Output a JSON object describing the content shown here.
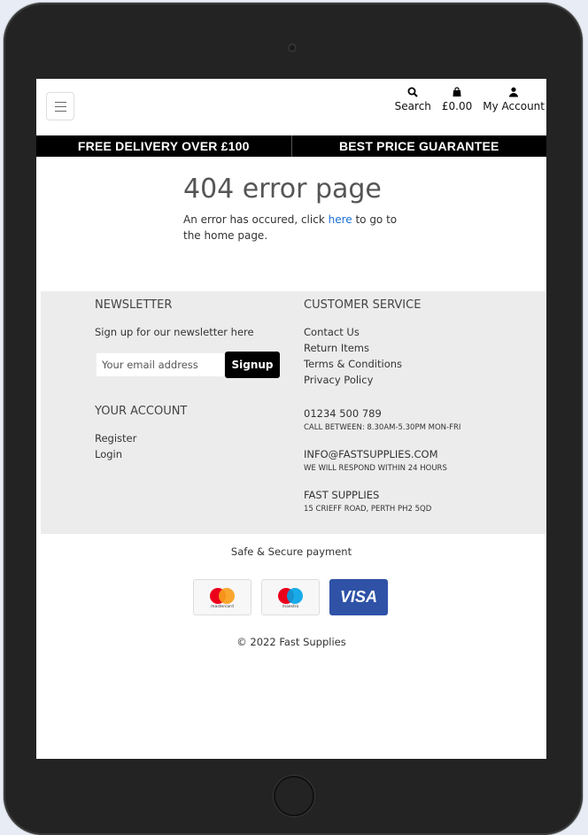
{
  "header": {
    "search_label": "Search",
    "basket_total": "£0.00",
    "account_label": "My Account"
  },
  "banner": {
    "left": "FREE DELIVERY OVER £100",
    "right": "BEST PRICE GUARANTEE"
  },
  "error": {
    "title": "404 error page",
    "message_before": "An error has occured, click ",
    "link_text": "here",
    "message_after": " to go to the home page."
  },
  "footer": {
    "newsletter": {
      "heading": "NEWSLETTER",
      "text": "Sign up for our newsletter here",
      "placeholder": "Your email address",
      "button": "Signup"
    },
    "account": {
      "heading": "YOUR ACCOUNT",
      "links": [
        "Register",
        "Login"
      ]
    },
    "customer_service": {
      "heading": "CUSTOMER SERVICE",
      "links": [
        "Contact Us",
        "Return Items",
        "Terms & Conditions",
        "Privacy Policy"
      ],
      "phone": "01234 500 789",
      "phone_note": "CALL BETWEEN: 8.30AM-5.30PM MON-FRI",
      "email": "INFO@FASTSUPPLIES.COM",
      "email_note": "WE WILL RESPOND WITHIN 24 HOURS",
      "company": "FAST SUPPLIES",
      "address": "15 CRIEFF ROAD, PERTH PH2 5QD"
    }
  },
  "payment": {
    "title": "Safe & Secure payment",
    "cards": [
      {
        "name": "mastercard",
        "label": "mastercard"
      },
      {
        "name": "maestro",
        "label": "maestro"
      },
      {
        "name": "visa",
        "label": "VISA"
      }
    ]
  },
  "copyright": "© 2022 Fast Supplies",
  "colors": {
    "banner_bg": "#000000",
    "footer_bg": "#ececec",
    "link": "#1a6fd6",
    "visa_blue": "#2f52a7",
    "mc_red": "#eb001b",
    "mc_orange": "#f79e1b",
    "maestro_blue": "#00a2e5"
  }
}
